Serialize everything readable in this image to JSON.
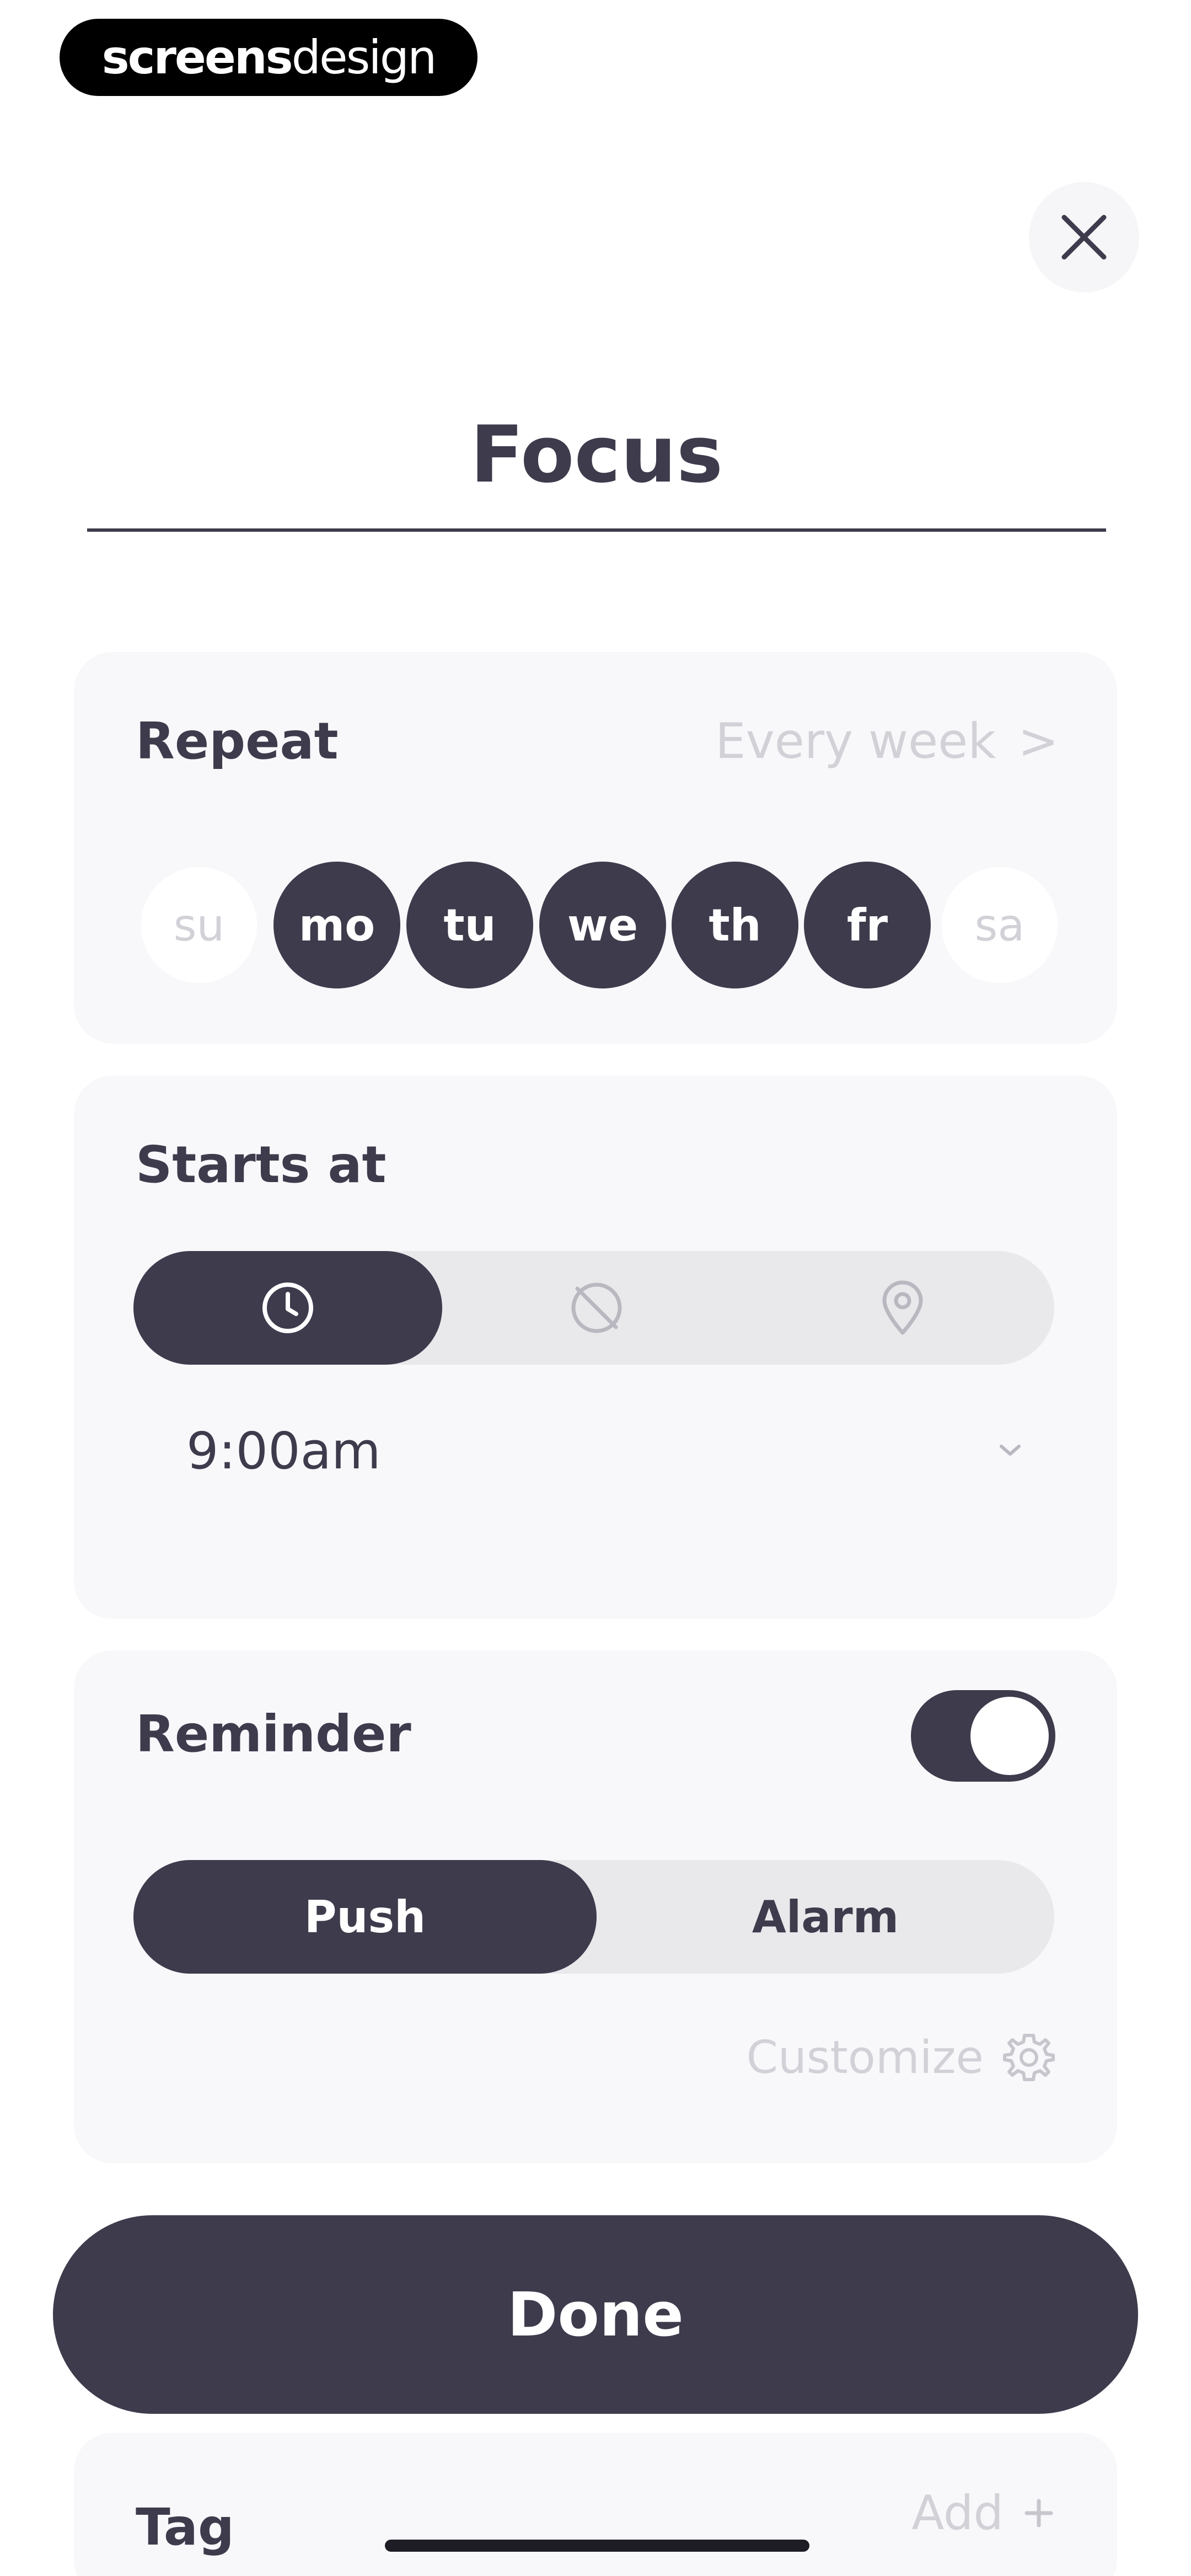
{
  "watermark": {
    "part1": "screens",
    "part2": "design"
  },
  "header": {
    "close_icon": "close-icon"
  },
  "title": {
    "value": "Focus"
  },
  "repeat": {
    "label": "Repeat",
    "value": "Every week",
    "chevron": ">",
    "days": [
      {
        "label": "su",
        "selected": false
      },
      {
        "label": "mo",
        "selected": true
      },
      {
        "label": "tu",
        "selected": true
      },
      {
        "label": "we",
        "selected": true
      },
      {
        "label": "th",
        "selected": true
      },
      {
        "label": "fr",
        "selected": true
      },
      {
        "label": "sa",
        "selected": false
      }
    ]
  },
  "starts_at": {
    "label": "Starts at",
    "modes": [
      {
        "icon": "clock-icon",
        "selected": true
      },
      {
        "icon": "no-time-icon",
        "selected": false
      },
      {
        "icon": "location-pin-icon",
        "selected": false
      }
    ],
    "time": "9:00am",
    "dropdown_icon": "chevron-down-icon"
  },
  "reminder": {
    "label": "Reminder",
    "enabled": true,
    "options": [
      {
        "label": "Push",
        "selected": true
      },
      {
        "label": "Alarm",
        "selected": false
      }
    ],
    "customize_label": "Customize",
    "customize_icon": "gear-icon"
  },
  "done": {
    "label": "Done"
  },
  "tag": {
    "label": "Tag",
    "add_label": "Add",
    "add_icon": "plus-icon"
  },
  "colors": {
    "primary": "#3d3b4c",
    "card_bg": "#f8f8fb",
    "muted_text": "#d2d1d7",
    "segment_bg": "#e9e9ec"
  }
}
